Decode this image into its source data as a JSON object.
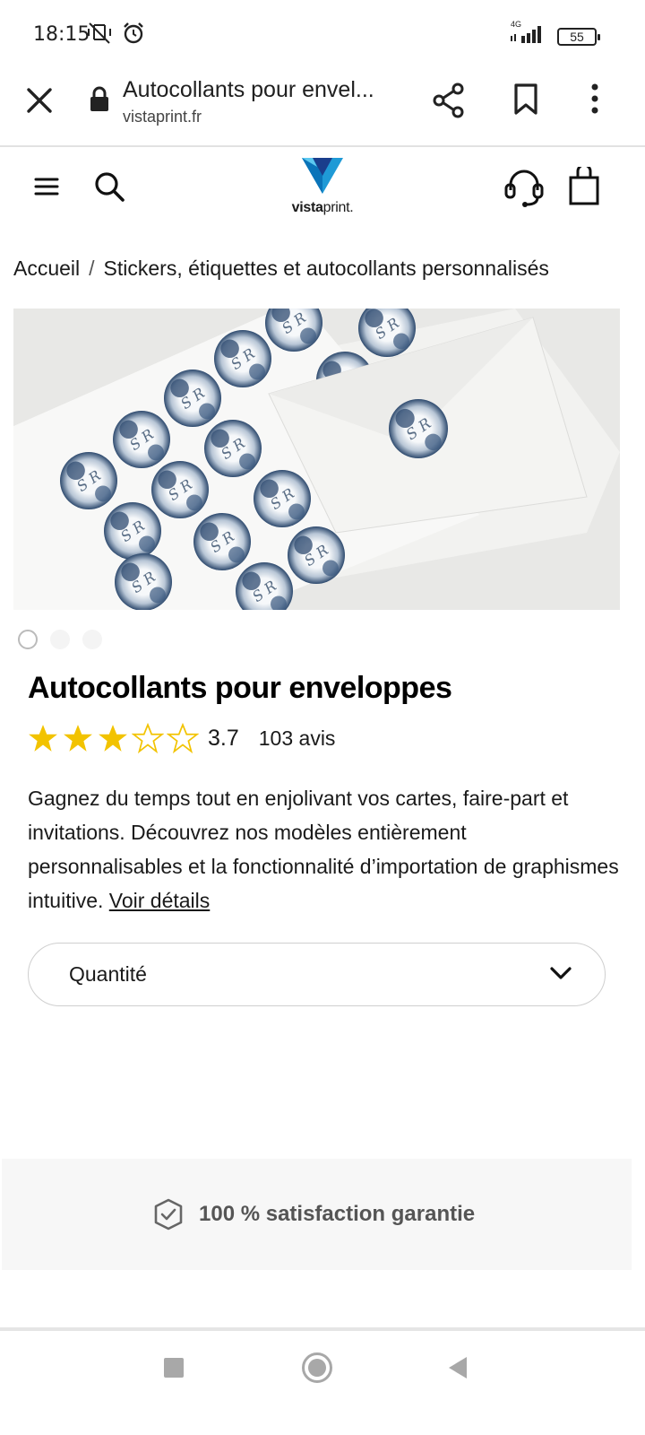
{
  "status_bar": {
    "time": "18:15",
    "network": "4G",
    "battery": "55"
  },
  "browser": {
    "page_title": "Autocollants pour envel...",
    "url": "vistaprint.fr"
  },
  "header": {
    "logo_bold": "vista",
    "logo_regular": "print",
    "logo_suffix": "."
  },
  "breadcrumb": {
    "home": "Accueil",
    "separator": "/",
    "category": "Stickers, étiquettes et autocollants personnalisés"
  },
  "product": {
    "title": "Autocollants pour enveloppes",
    "rating_value": "3.7",
    "rating_stars": 3.7,
    "review_count": "103 avis",
    "description": "Gagnez du temps tout en enjolivant vos cartes, faire-part et invitations. Découvrez nos modèles entièrement personnalisables et la fonctionnalité d’importation de graphismes intuitive.",
    "details_link": "Voir détails",
    "quantity_label": "Quantité",
    "sticker_monogram": "S R"
  },
  "guarantee": {
    "text": "100 % satisfaction garantie"
  },
  "colors": {
    "star": "#f2c300",
    "logo_blue": "#1f9ad6",
    "logo_dark": "#1a3e8c"
  },
  "icons": {
    "close": "close-icon",
    "lock": "lock-icon",
    "share": "share-icon",
    "bookmark": "bookmark-icon",
    "menu": "more-vert-icon",
    "hamburger": "hamburger-icon",
    "search": "search-icon",
    "support": "headset-icon",
    "cart": "shopping-bag-icon",
    "chevron": "chevron-down-icon",
    "guarantee": "shield-check-icon"
  }
}
